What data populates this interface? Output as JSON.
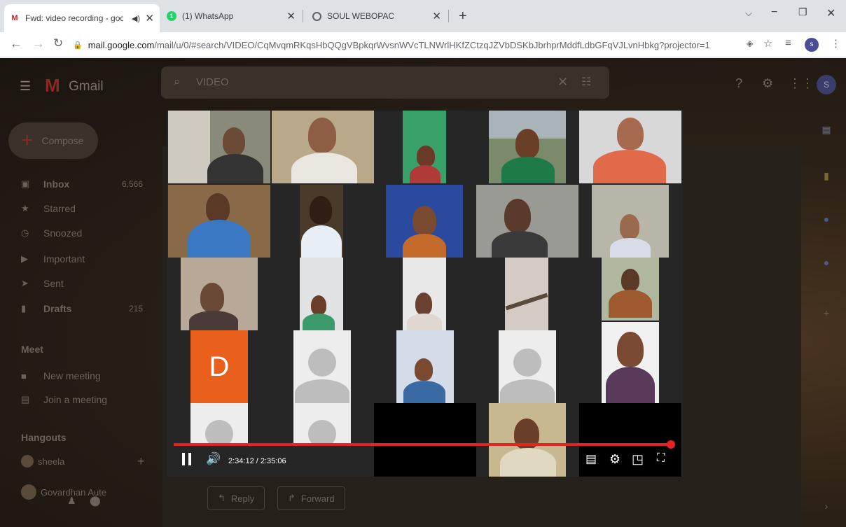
{
  "browser": {
    "tabs": [
      {
        "icon": "gmail-icon",
        "title": "Fwd: video recording - godb",
        "active": true
      },
      {
        "icon": "whatsapp-icon",
        "title": "(1) WhatsApp",
        "active": false
      },
      {
        "icon": "globe-icon",
        "title": "SOUL WEBOPAC",
        "active": false
      }
    ],
    "url_host": "mail.google.com",
    "url_path": "/mail/u/0/#search/VIDEO/CqMvqmRKqsHbQQgVBpkqrWvsnWVcTLNWrlHKfZCtzqJZVbDSKbJbrhprMddfLdbGFqVJLvnHbkg?projector=1",
    "profile_initial": "s"
  },
  "gmail": {
    "app_name": "Gmail",
    "search_query": "VIDEO",
    "compose_label": "Compose",
    "nav": [
      {
        "label": "Inbox",
        "count": "6,566",
        "icon": "inbox-icon"
      },
      {
        "label": "Starred",
        "count": "",
        "icon": "star-icon"
      },
      {
        "label": "Snoozed",
        "count": "",
        "icon": "clock-icon"
      },
      {
        "label": "Important",
        "count": "",
        "icon": "important-icon"
      },
      {
        "label": "Sent",
        "count": "",
        "icon": "send-icon"
      },
      {
        "label": "Drafts",
        "count": "215",
        "icon": "draft-icon"
      }
    ],
    "meet_title": "Meet",
    "meet_items": [
      {
        "label": "New meeting",
        "icon": "video-camera-icon"
      },
      {
        "label": "Join a meeting",
        "icon": "keyboard-icon"
      }
    ],
    "hangouts_title": "Hangouts",
    "hangout_user": "sheela",
    "hangout_contact": "Govardhan Aute",
    "reply_label": "Reply",
    "forward_label": "Forward",
    "avatar_initial": "S"
  },
  "video": {
    "time_current": "2:34:12",
    "time_total": "2:35:06",
    "progress": 0.994,
    "placeholder_letter": "D"
  }
}
